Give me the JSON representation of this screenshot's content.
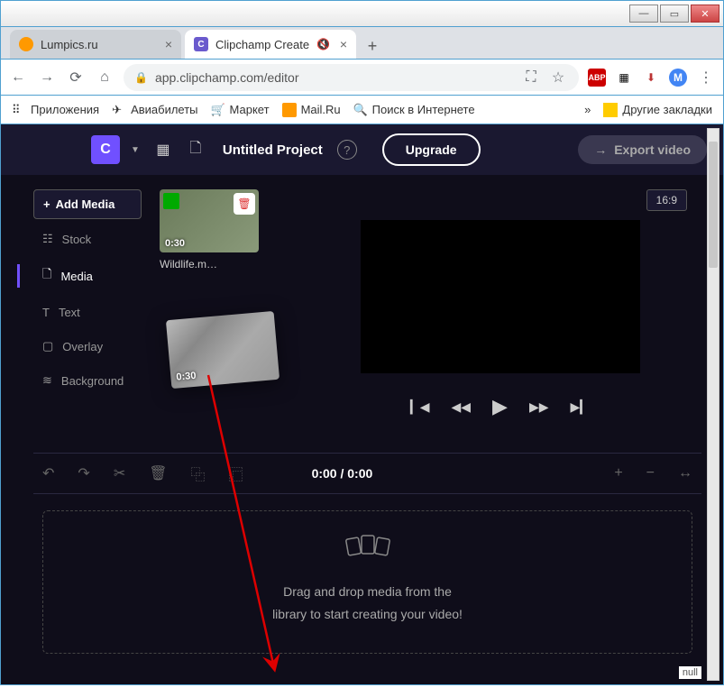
{
  "window": {
    "minimize": "—",
    "maximize": "▭",
    "close": "✕"
  },
  "tabs": {
    "tab1": "Lumpics.ru",
    "tab2": "Clipchamp Create",
    "sound": "🔇"
  },
  "address": {
    "back": "←",
    "forward": "→",
    "reload": "⟳",
    "home": "⌂",
    "url": "app.clipchamp.com/editor",
    "translate": "⛶",
    "star": "☆",
    "ext_abp": "ABP",
    "ext_m": "M",
    "menu": "⋮"
  },
  "bookmarks": {
    "apps": "Приложения",
    "avia": "Авиабилеты",
    "market": "Маркет",
    "mailru": "Mail.Ru",
    "search": "Поиск в Интернете",
    "more": "»",
    "other": "Другие закладки"
  },
  "header": {
    "logo": "C",
    "project": "Untitled Project",
    "help": "?",
    "upgrade": "Upgrade",
    "export": "Export video",
    "export_arrow": "→"
  },
  "sidebar": {
    "add": "Add Media",
    "plus": "+",
    "items": [
      {
        "icon": "☷",
        "label": "Stock"
      },
      {
        "icon": "🗋",
        "label": "Media"
      },
      {
        "icon": "T",
        "label": "Text"
      },
      {
        "icon": "▢",
        "label": "Overlay"
      },
      {
        "icon": "≋",
        "label": "Background"
      }
    ]
  },
  "media": {
    "duration": "0:30",
    "name": "Wildlife.m…",
    "drag_duration": "0:30"
  },
  "preview": {
    "aspect": "16:9",
    "prev_clip": "▎◀",
    "rewind": "◀◀",
    "play": "▶",
    "forward": "▶▶",
    "next_clip": "▶▎"
  },
  "toolbar": {
    "undo": "↶",
    "redo": "↷",
    "cut": "✂",
    "delete": "🗑",
    "copy": "⿻",
    "dup": "⿸",
    "time": "0:00 / 0:00",
    "zoom_in": "+",
    "zoom_out": "−",
    "fit": "↔"
  },
  "dropzone": {
    "line1": "Drag and drop media from the",
    "line2": "library to start creating your video!"
  },
  "null_label": "null"
}
